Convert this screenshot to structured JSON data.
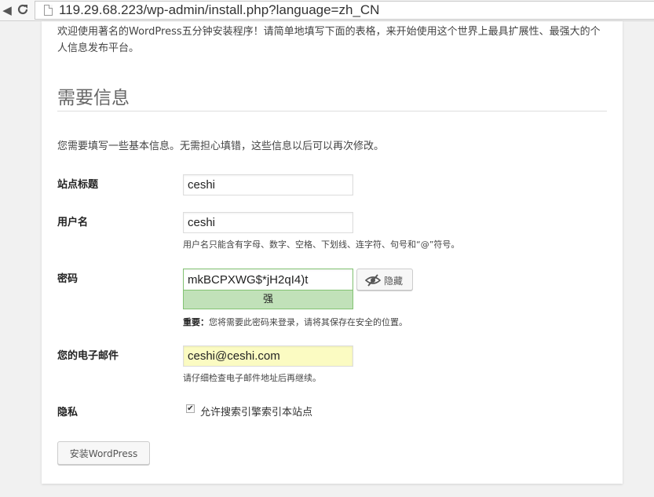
{
  "browser": {
    "url": "119.29.68.223/wp-admin/install.php?language=zh_CN",
    "back_icon": "back-arrow-icon",
    "reload_icon": "reload-icon"
  },
  "intro_text": "欢迎使用著名的WordPress五分钟安装程序！请简单地填写下面的表格，来开始使用这个世界上最具扩展性、最强大的个人信息发布平台。",
  "section_heading": "需要信息",
  "description": "您需要填写一些基本信息。无需担心填错，这些信息以后可以再次修改。",
  "form": {
    "site_title": {
      "label": "站点标题",
      "value": "ceshi"
    },
    "username": {
      "label": "用户名",
      "value": "ceshi",
      "hint": "用户名只能含有字母、数字、空格、下划线、连字符、句号和“@”符号。"
    },
    "password": {
      "label": "密码",
      "value": "mkBCPXWG$*jH2qI4)t",
      "strength": "强",
      "hide_label": "隐藏",
      "hide_icon": "eye-slash-icon",
      "hint_bold": "重要：",
      "hint": "您将需要此密码来登录，请将其保存在安全的位置。"
    },
    "email": {
      "label": "您的电子邮件",
      "value": "ceshi@ceshi.com",
      "hint": "请仔细检查电子邮件地址后再继续。"
    },
    "privacy": {
      "label": "隐私",
      "checkbox_label": "允许搜索引擎索引本站点",
      "checked": true
    },
    "submit_label": "安装WordPress"
  },
  "colors": {
    "strength_bg": "#c1e1b9",
    "strength_border": "#83c373",
    "email_bg": "#fbfbc2"
  }
}
